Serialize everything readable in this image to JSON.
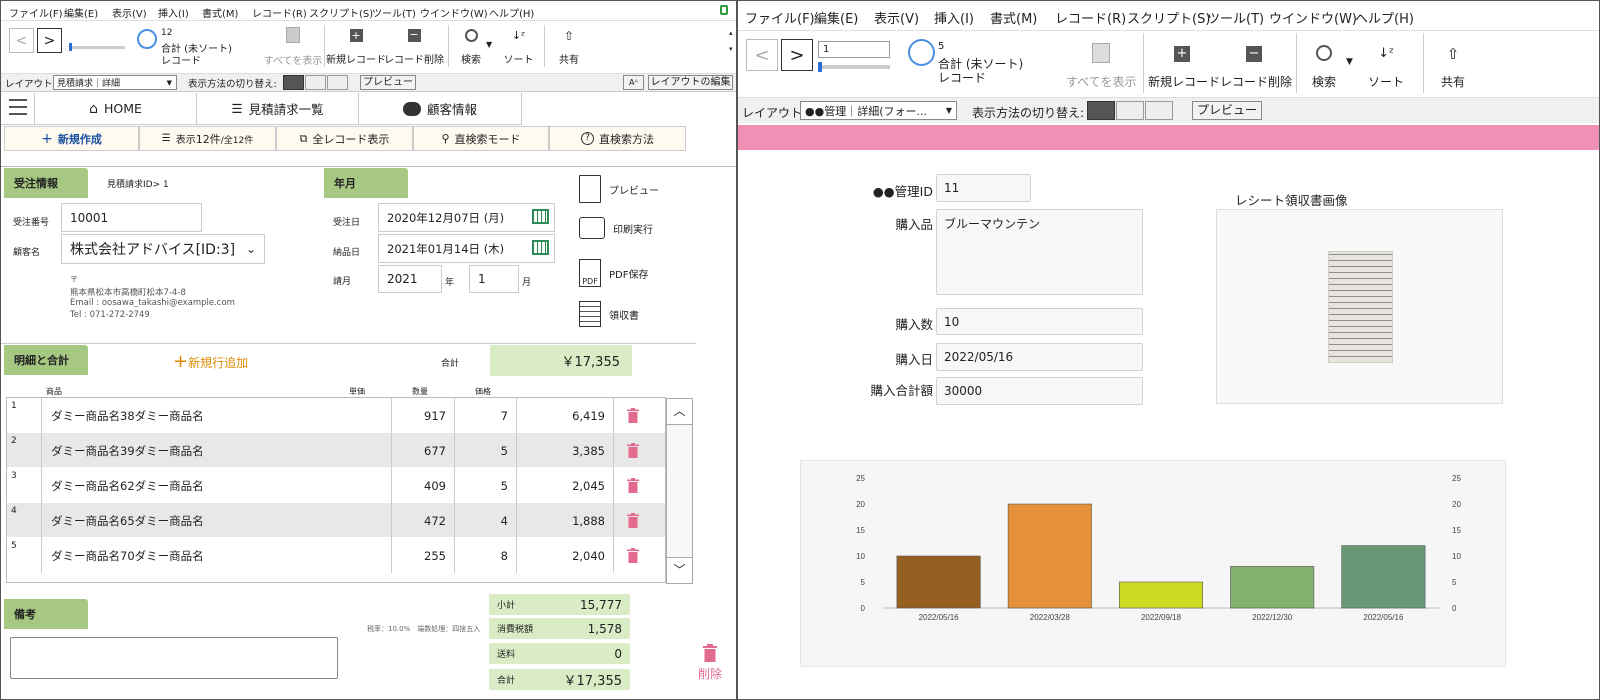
{
  "left": {
    "menu": [
      "ファイル(F)",
      "編集(E)",
      "表示(V)",
      "挿入(I)",
      "書式(M)",
      "レコード(R)",
      "スクリプト(S)",
      "ツール(T)",
      "ウインドウ(W)",
      "ヘルプ(H)"
    ],
    "record_num": "12",
    "record_status": "合計 (未ソート)",
    "record_word": "レコード",
    "tools": {
      "show_all": "すべてを表示",
      "new_record": "新規レコード",
      "delete_record": "レコード削除",
      "find": "検索",
      "sort": "ソート",
      "share": "共有"
    },
    "layout_label": "レイアウト:",
    "layout_value": "見積請求｜詳細",
    "view_as": "表示方法の切り替え:",
    "preview": "プレビュー",
    "aa": "Aᴬ",
    "edit_layout": "レイアウトの編集",
    "nav": [
      "HOME",
      "見積請求一覧",
      "顧客情報"
    ],
    "nav2": {
      "new": "新規作成",
      "count_pre": "表示",
      "count": "12件",
      "count_total": "/全12件",
      "all_records": "全レコード表示",
      "find_mode": "直検索モード",
      "find_help": "直検索方法"
    },
    "order_section": "受注情報",
    "quote_id": "見積請求ID> 1",
    "order_no_label": "受注番号",
    "order_no": "10001",
    "customer_label": "顧客名",
    "customer": "株式会社アドバイス[ID:3]",
    "address": [
      "〒",
      "熊本県松本市高橋町松本7-4-8",
      "Email : oosawa_takashi@example.com",
      "Tel : 071-272-2749"
    ],
    "year_section": "年月",
    "order_date_label": "受注日",
    "order_date": "2020年12月07日 (月)",
    "delivery_label": "納品日",
    "delivery_date": "2021年01月14日 (木)",
    "month_label": "請月",
    "year_value": "2021",
    "year_unit": "年",
    "month_value": "1",
    "month_unit": "月",
    "actions": [
      "プレビュー",
      "印刷実行",
      "PDF保存",
      "領収書"
    ],
    "detail_section": "明細と合計",
    "add_row": "新規行追加",
    "total_label": "合計",
    "total_value": "￥17,355",
    "cols": [
      "商品",
      "単価",
      "数量",
      "価格"
    ],
    "rows": [
      {
        "n": "1",
        "name": "ダミー商品名38ダミー商品名",
        "price": "917",
        "qty": "7",
        "amount": "6,419"
      },
      {
        "n": "2",
        "name": "ダミー商品名39ダミー商品名",
        "price": "677",
        "qty": "5",
        "amount": "3,385"
      },
      {
        "n": "3",
        "name": "ダミー商品名62ダミー商品名",
        "price": "409",
        "qty": "5",
        "amount": "2,045"
      },
      {
        "n": "4",
        "name": "ダミー商品名65ダミー商品名",
        "price": "472",
        "qty": "4",
        "amount": "1,888"
      },
      {
        "n": "5",
        "name": "ダミー商品名70ダミー商品名",
        "price": "255",
        "qty": "8",
        "amount": "2,040"
      }
    ],
    "notes_section": "備考",
    "tax_note": "税率：10.0%　端数処理：四捨五入",
    "totals": [
      {
        "label": "小計",
        "value": "15,777"
      },
      {
        "label": "消費税額",
        "value": "1,578"
      },
      {
        "label": "送料",
        "value": "0"
      },
      {
        "label": "合計",
        "value": "￥17,355"
      }
    ],
    "delete": "削除"
  },
  "right": {
    "menu": [
      "ファイル(F)",
      "編集(E)",
      "表示(V)",
      "挿入(I)",
      "書式(M)",
      "レコード(R)",
      "スクリプト(S)",
      "ツール(T)",
      "ウインドウ(W)",
      "ヘルプ(H)"
    ],
    "record_input": "1",
    "record_num": "5",
    "record_status": "合計 (未ソート)",
    "record_word": "レコード",
    "tools": {
      "show_all": "すべてを表示",
      "new_record": "新規レコード",
      "delete_record": "レコード削除",
      "find": "検索",
      "sort": "ソート",
      "share": "共有"
    },
    "layout_label": "レイアウト:",
    "layout_value": "●●管理｜詳細(フォー...",
    "view_as": "表示方法の切り替え:",
    "preview": "プレビュー",
    "header_color": "#f090b4",
    "id_label": "●●管理ID",
    "id_value": "11",
    "item_label": "購入品",
    "item_value": "ブルーマウンテン",
    "qty_label": "購入数",
    "qty_value": "10",
    "date_label": "購入日",
    "date_value": "2022/05/16",
    "sum_label": "購入合計額",
    "sum_value": "30000",
    "receipt_label": "レシート領収書画像"
  },
  "chart_data": {
    "type": "bar",
    "categories": [
      "2022/05/16",
      "2022/03/28",
      "2022/09/18",
      "2022/12/30",
      "2022/05/16"
    ],
    "values": [
      10,
      20,
      5,
      8,
      12
    ],
    "colors": [
      "#955f21",
      "#e69139",
      "#cddc22",
      "#81b36e",
      "#679977"
    ],
    "ylim": [
      0,
      25
    ],
    "yticks": [
      0,
      5,
      10,
      15,
      20,
      25
    ],
    "grid": false,
    "title": "",
    "xlabel": "",
    "ylabel": ""
  }
}
